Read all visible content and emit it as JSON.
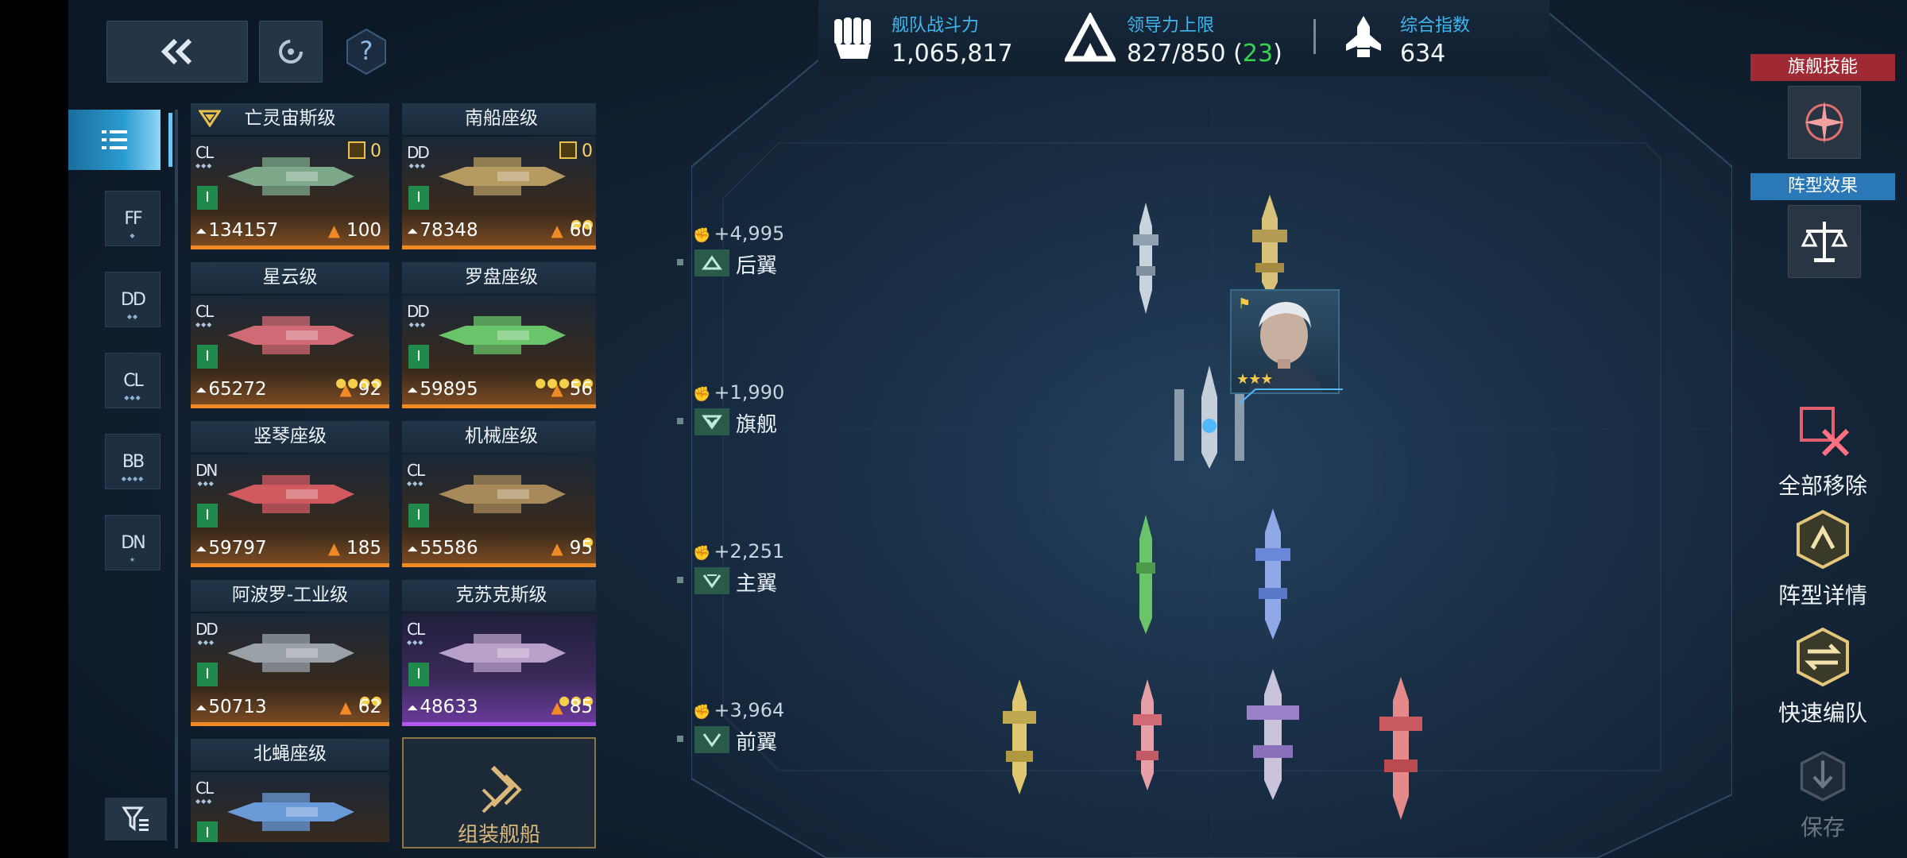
{
  "header": {
    "back_icon": "double-chevron-left-icon",
    "refresh_icon": "refresh-icon",
    "help_icon": "question-icon",
    "help_label": "?"
  },
  "stats": {
    "fleet_power_label": "舰队战斗力",
    "fleet_power_value": "1,065,817",
    "leadership_label": "领导力上限",
    "leadership_value": "827/850",
    "leadership_extra": "23",
    "composite_label": "综合指数",
    "composite_value": "634"
  },
  "tabs": [
    {
      "label": "FF"
    },
    {
      "label": "DD"
    },
    {
      "label": "CL"
    },
    {
      "label": "BB"
    },
    {
      "label": "DN"
    }
  ],
  "ships": [
    {
      "name": "亡灵宙斯级",
      "class": "CL",
      "tier": "I",
      "power": "134157",
      "lead": "100",
      "badge": "0",
      "pips": "",
      "color": "#7da88a"
    },
    {
      "name": "南船座级",
      "class": "DD",
      "tier": "I",
      "power": "78348",
      "lead": "60",
      "badge": "0",
      "pips": "●●",
      "color": "#b59a62"
    },
    {
      "name": "星云级",
      "class": "CL",
      "tier": "I",
      "power": "65272",
      "lead": "92",
      "badge": "",
      "pips": "●●●●",
      "color": "#d06a74"
    },
    {
      "name": "罗盘座级",
      "class": "DD",
      "tier": "I",
      "power": "59895",
      "lead": "56",
      "badge": "",
      "pips": "●●●●●",
      "color": "#6ac46a"
    },
    {
      "name": "竖琴座级",
      "class": "DN",
      "tier": "I",
      "power": "59797",
      "lead": "185",
      "badge": "",
      "pips": "",
      "color": "#d05a60"
    },
    {
      "name": "机械座级",
      "class": "CL",
      "tier": "I",
      "power": "55586",
      "lead": "95",
      "badge": "",
      "pips": "●",
      "color": "#a88a5a"
    },
    {
      "name": "阿波罗-工业级",
      "class": "DD",
      "tier": "I",
      "power": "50713",
      "lead": "62",
      "badge": "",
      "pips": "●●",
      "color": "#9aa0a8"
    },
    {
      "name": "克苏克斯级",
      "class": "CL",
      "tier": "I",
      "power": "48633",
      "lead": "85",
      "badge": "",
      "pips": "●●●",
      "color": "#b9a0c8"
    },
    {
      "name": "北蝇座级",
      "class": "CL",
      "tier": "I",
      "power": "",
      "lead": "",
      "badge": "",
      "pips": "●●●",
      "color": "#6a9ad8"
    }
  ],
  "assemble_label": "组装舰船",
  "rows": [
    {
      "bonus": "+4,995",
      "name": "后翼"
    },
    {
      "bonus": "+1,990",
      "name": "旗舰"
    },
    {
      "bonus": "+2,251",
      "name": "主翼"
    },
    {
      "bonus": "+3,964",
      "name": "前翼"
    }
  ],
  "commander": {
    "stars": "★★★",
    "portrait": "commander-portrait"
  },
  "right_panel": {
    "flagship_skill_label": "旗舰技能",
    "formation_effect_label": "阵型效果",
    "remove_all_label": "全部移除",
    "formation_detail_label": "阵型详情",
    "quick_form_label": "快速编队",
    "save_label": "保存"
  },
  "colors": {
    "accent_blue": "#3fb6ee",
    "green": "#39d353",
    "orange": "#f08a24",
    "purple": "#b25aee",
    "red_tag": "#a02a34",
    "blue_tag": "#2b78b8"
  }
}
